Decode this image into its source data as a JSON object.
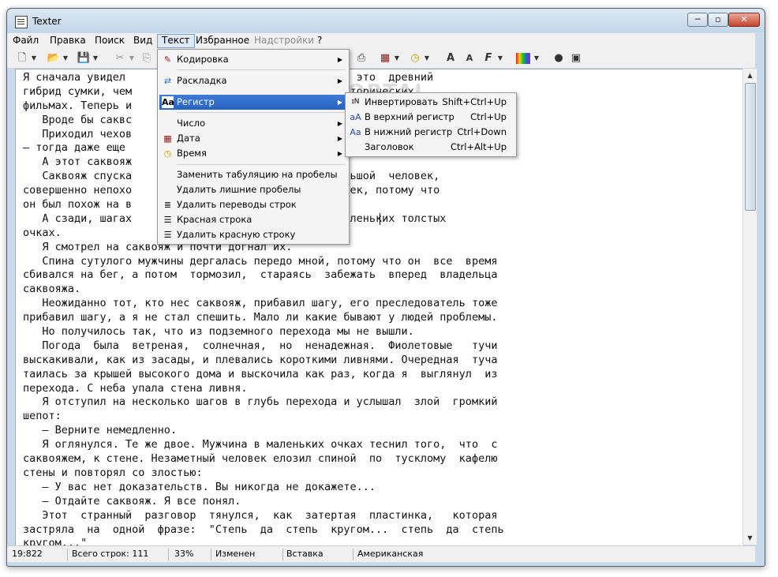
{
  "window": {
    "title": "Texter",
    "min_glyph": "0",
    "max_glyph": "1",
    "close_glyph": "r"
  },
  "menubar": {
    "items": [
      {
        "label": "Файл"
      },
      {
        "label": "Правка"
      },
      {
        "label": "Поиск"
      },
      {
        "label": "Вид"
      },
      {
        "label": "Текст"
      },
      {
        "label": "Избранное"
      },
      {
        "label": "Надстройки"
      },
      {
        "label": "?"
      }
    ]
  },
  "toolbar": {
    "icons": [
      "new-icon",
      "open-icon",
      "save-icon",
      "cut-icon",
      "copy-icon",
      "print-icon",
      "calendar-icon",
      "clock-icon",
      "font-size-up-icon",
      "font-size-down-icon",
      "font-icon",
      "color-palette-icon",
      "record-icon",
      "window-icon"
    ]
  },
  "editor": {
    "lines": [
      "Я сначала увидел                 чика.  Саквояж  –  это  древний",
      "гибрид сумки, чем                      доктора в исторических",
      "фильмах. Теперь и",
      "   Вроде бы саквс",
      "   Приходил чехов                                      ли  микстуру",
      "– тогда даже еще",
      "   А этот саквояж",
      "   Саквояж спуска               д.  Его  нес  небольшой  человек,",
      "совершенно непохо               го не похожий человек, потому что",
      "он был похож на в",
      "   А сзади, шагах                тулый мужчина в маленьких толстых",
      "очках.",
      "   Я смотрел на саквояж и почти догнал их.",
      "   Спина сутулого мужчины дергалась передо мной, потому что он  все  время",
      "сбивался на бег, а потом  тормозил,  стараясь  забежать  вперед  владельца",
      "саквояжа.",
      "   Неожиданно тот, кто нес саквояж, прибавил шагу, его преследователь тоже",
      "прибавил шагу, а я не стал спешить. Мало ли какие бывают у людей проблемы.",
      "   Но получилось так, что из подземного перехода мы не вышли.",
      "   Погода  была  ветреная,  солнечная,  но  ненадежная.  Фиолетовые   тучи",
      "выскакивали, как из засады, и плевались короткими ливнями. Очередная  туча",
      "таилась за крышей высокого дома и выскочила как раз, когда я  выглянул  из",
      "перехода. С неба упала стена ливня.",
      "   Я отступил на несколько шагов в глубь перехода и услышал  злой  громкий",
      "шепот:",
      "   – Верните немедленно.",
      "   Я оглянулся. Те же двое. Мужчина в маленьких очках теснил того,  что  с",
      "саквояжем, к стене. Незаметный человек елозил спиной  по  тусклому  кафелю",
      "стены и повторял со злостью:",
      "   – У вас нет доказательств. Вы никогда не докажете...",
      "   – Отдайте саквояж. Я все понял.",
      "   Этот  странный  разговор  тянулся,  как  затертая  пластинка,   которая",
      "застряла  на  одной  фразе:  \"Степь  да  степь  кругом...  степь  да  степь",
      "кругом...\""
    ]
  },
  "watermark": "SOFTPORTAL",
  "text_menu": {
    "items": [
      {
        "label": "Кодировка",
        "icon": "encoding-icon",
        "submenu": true
      },
      {
        "label": "Раскладка",
        "icon": "layout-icon",
        "submenu": true
      },
      {
        "label": "Регистр",
        "icon": "case-icon",
        "submenu": true,
        "highlighted": true
      },
      {
        "label": "Число",
        "icon": "",
        "submenu": true
      },
      {
        "label": "Дата",
        "icon": "calendar-icon",
        "submenu": true
      },
      {
        "label": "Время",
        "icon": "clock-icon",
        "submenu": true
      },
      {
        "label": "Заменить табуляцию на пробелы",
        "icon": ""
      },
      {
        "label": "Удалить лишние пробелы",
        "icon": ""
      },
      {
        "label": "Удалить переводы строк",
        "icon": "remove-linebreaks-icon"
      },
      {
        "label": "Красная строка",
        "icon": "indent-icon"
      },
      {
        "label": "Удалить красную строку",
        "icon": "remove-indent-icon"
      }
    ]
  },
  "case_submenu": {
    "items": [
      {
        "label": "Инвертировать",
        "shortcut": "Shift+Ctrl+Up",
        "icon": "invert-case-icon"
      },
      {
        "label": "В верхний регистр",
        "shortcut": "Ctrl+Up",
        "icon": "uppercase-icon"
      },
      {
        "label": "В нижний регистр",
        "shortcut": "Ctrl+Down",
        "icon": "lowercase-icon"
      },
      {
        "label": "Заголовок",
        "shortcut": "Ctrl+Alt+Up",
        "icon": ""
      }
    ]
  },
  "statusbar": {
    "position": "19:822",
    "lines": "Всего строк: 111",
    "percent": "33%",
    "modified": "Изменен",
    "insert": "Вставка",
    "layout": "Американская"
  }
}
